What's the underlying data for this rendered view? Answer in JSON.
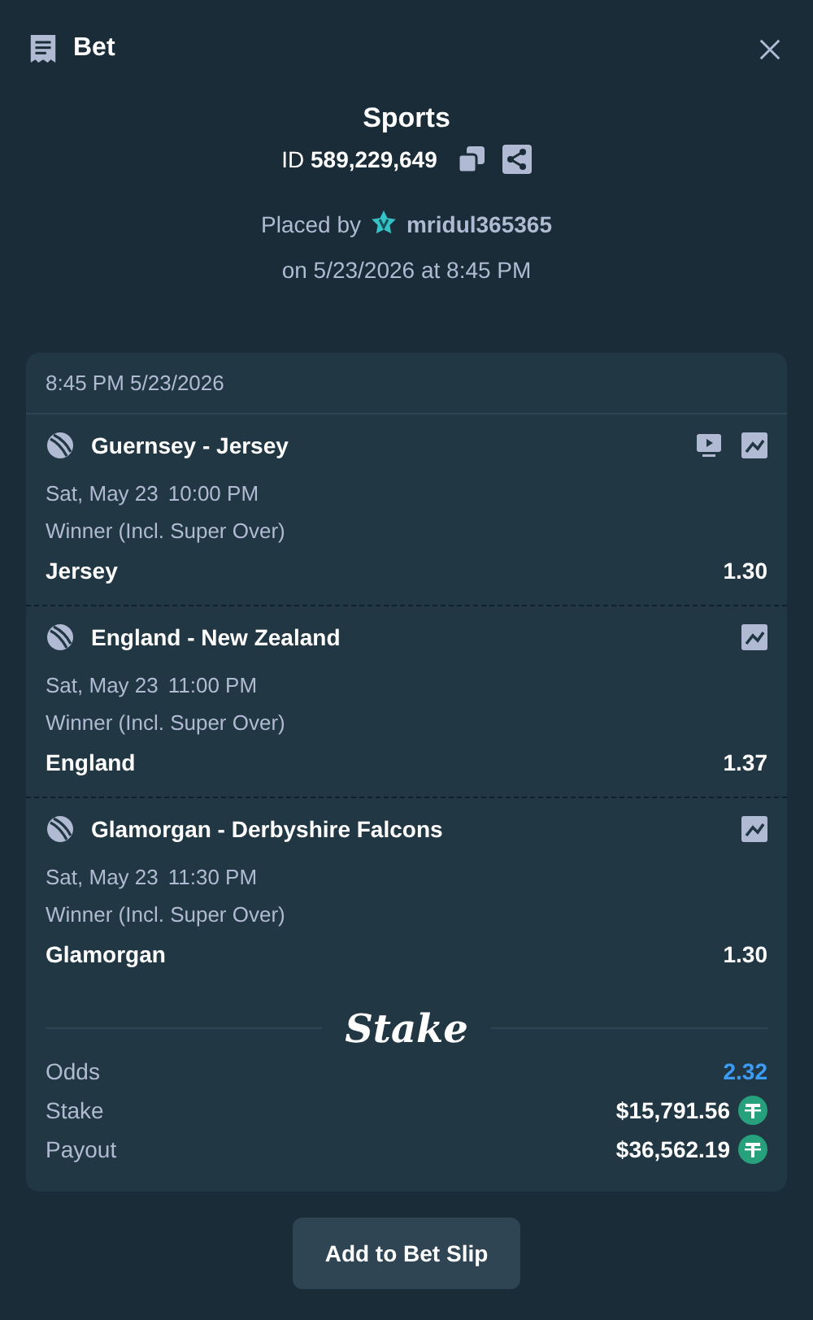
{
  "header": {
    "title": "Bet"
  },
  "summary": {
    "category": "Sports",
    "id_label": "ID",
    "id_value": "589,229,649",
    "placed_by": "Placed by",
    "username": "mridul365365",
    "placed_on": "on 5/23/2026 at 8:45 PM"
  },
  "card": {
    "timestamp": "8:45 PM 5/23/2026",
    "events": [
      {
        "match": "Guernsey - Jersey",
        "stream": true,
        "date": "Sat, May 23",
        "time": "10:00 PM",
        "market": "Winner (Incl. Super Over)",
        "outcome": "Jersey",
        "odds": "1.30"
      },
      {
        "match": "England - New Zealand",
        "stream": false,
        "date": "Sat, May 23",
        "time": "11:00 PM",
        "market": "Winner (Incl. Super Over)",
        "outcome": "England",
        "odds": "1.37"
      },
      {
        "match": "Glamorgan - Derbyshire Falcons",
        "stream": false,
        "date": "Sat, May 23",
        "time": "11:30 PM",
        "market": "Winner (Incl. Super Over)",
        "outcome": "Glamorgan",
        "odds": "1.30"
      }
    ],
    "logo": "Stake",
    "totals": [
      {
        "kind": "odds",
        "label": "Odds",
        "value": "2.32"
      },
      {
        "kind": "amount",
        "label": "Stake",
        "value": "$15,791.56"
      },
      {
        "kind": "amount",
        "label": "Payout",
        "value": "$36,562.19"
      }
    ]
  },
  "button": "Add to Bet Slip"
}
